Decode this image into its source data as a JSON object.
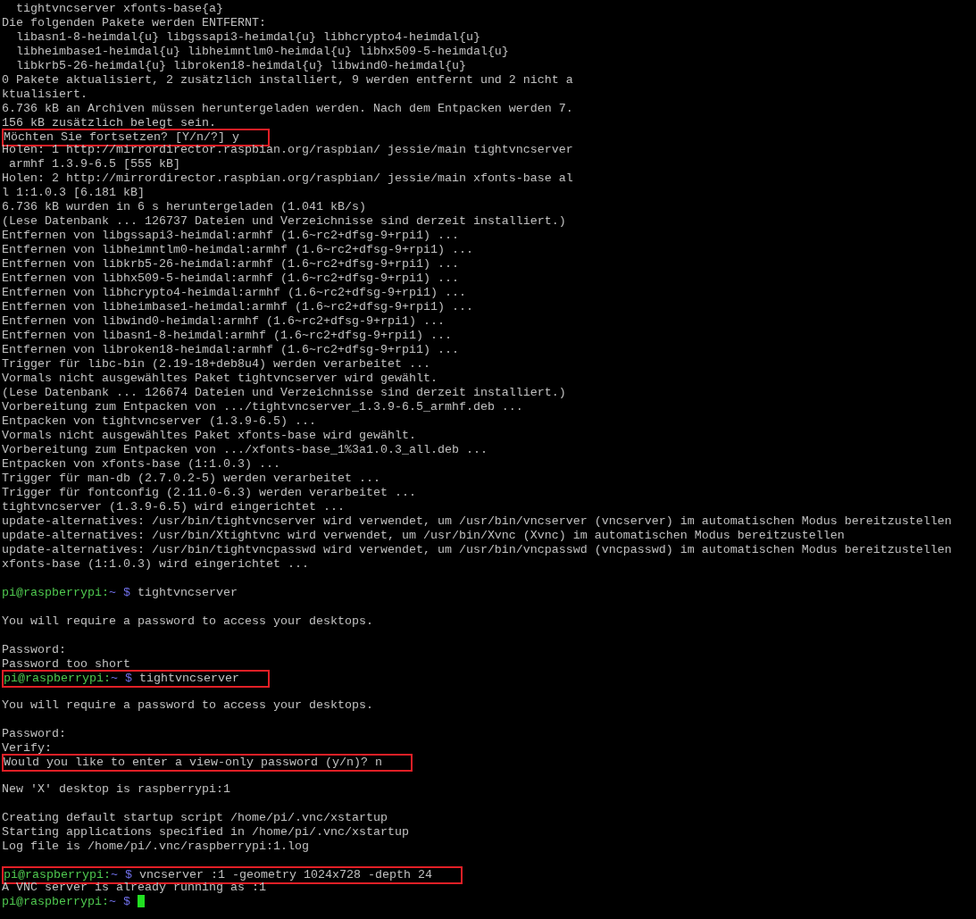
{
  "terminal": {
    "lines": [
      {
        "kind": "text",
        "text": "  tightvncserver xfonts-base{a}",
        "highlighted": false
      },
      {
        "kind": "text",
        "text": "Die folgenden Pakete werden ENTFERNT:",
        "highlighted": false
      },
      {
        "kind": "text",
        "text": "  libasn1-8-heimdal{u} libgssapi3-heimdal{u} libhcrypto4-heimdal{u}",
        "highlighted": false
      },
      {
        "kind": "text",
        "text": "  libheimbase1-heimdal{u} libheimntlm0-heimdal{u} libhx509-5-heimdal{u}",
        "highlighted": false
      },
      {
        "kind": "text",
        "text": "  libkrb5-26-heimdal{u} libroken18-heimdal{u} libwind0-heimdal{u}",
        "highlighted": false
      },
      {
        "kind": "text",
        "text": "0 Pakete aktualisiert, 2 zusätzlich installiert, 9 werden entfernt und 2 nicht a",
        "highlighted": false
      },
      {
        "kind": "text",
        "text": "ktualisiert.",
        "highlighted": false
      },
      {
        "kind": "text",
        "text": "6.736 kB an Archiven müssen heruntergeladen werden. Nach dem Entpacken werden 7.",
        "highlighted": false
      },
      {
        "kind": "text",
        "text": "156 kB zusätzlich belegt sein.",
        "highlighted": false
      },
      {
        "kind": "text",
        "text": "Möchten Sie fortsetzen? [Y/n/?] y",
        "highlighted": true
      },
      {
        "kind": "text",
        "text": "Holen: 1 http://mirrordirector.raspbian.org/raspbian/ jessie/main tightvncserver",
        "highlighted": false
      },
      {
        "kind": "text",
        "text": " armhf 1.3.9-6.5 [555 kB]",
        "highlighted": false
      },
      {
        "kind": "text",
        "text": "Holen: 2 http://mirrordirector.raspbian.org/raspbian/ jessie/main xfonts-base al",
        "highlighted": false
      },
      {
        "kind": "text",
        "text": "l 1:1.0.3 [6.181 kB]",
        "highlighted": false
      },
      {
        "kind": "text",
        "text": "6.736 kB wurden in 6 s heruntergeladen (1.041 kB/s)",
        "highlighted": false
      },
      {
        "kind": "text",
        "text": "(Lese Datenbank ... 126737 Dateien und Verzeichnisse sind derzeit installiert.)",
        "highlighted": false
      },
      {
        "kind": "text",
        "text": "Entfernen von libgssapi3-heimdal:armhf (1.6~rc2+dfsg-9+rpi1) ...",
        "highlighted": false
      },
      {
        "kind": "text",
        "text": "Entfernen von libheimntlm0-heimdal:armhf (1.6~rc2+dfsg-9+rpi1) ...",
        "highlighted": false
      },
      {
        "kind": "text",
        "text": "Entfernen von libkrb5-26-heimdal:armhf (1.6~rc2+dfsg-9+rpi1) ...",
        "highlighted": false
      },
      {
        "kind": "text",
        "text": "Entfernen von libhx509-5-heimdal:armhf (1.6~rc2+dfsg-9+rpi1) ...",
        "highlighted": false
      },
      {
        "kind": "text",
        "text": "Entfernen von libhcrypto4-heimdal:armhf (1.6~rc2+dfsg-9+rpi1) ...",
        "highlighted": false
      },
      {
        "kind": "text",
        "text": "Entfernen von libheimbase1-heimdal:armhf (1.6~rc2+dfsg-9+rpi1) ...",
        "highlighted": false
      },
      {
        "kind": "text",
        "text": "Entfernen von libwind0-heimdal:armhf (1.6~rc2+dfsg-9+rpi1) ...",
        "highlighted": false
      },
      {
        "kind": "text",
        "text": "Entfernen von libasn1-8-heimdal:armhf (1.6~rc2+dfsg-9+rpi1) ...",
        "highlighted": false
      },
      {
        "kind": "text",
        "text": "Entfernen von libroken18-heimdal:armhf (1.6~rc2+dfsg-9+rpi1) ...",
        "highlighted": false
      },
      {
        "kind": "text",
        "text": "Trigger für libc-bin (2.19-18+deb8u4) werden verarbeitet ...",
        "highlighted": false
      },
      {
        "kind": "text",
        "text": "Vormals nicht ausgewähltes Paket tightvncserver wird gewählt.",
        "highlighted": false
      },
      {
        "kind": "text",
        "text": "(Lese Datenbank ... 126674 Dateien und Verzeichnisse sind derzeit installiert.)",
        "highlighted": false
      },
      {
        "kind": "text",
        "text": "Vorbereitung zum Entpacken von .../tightvncserver_1.3.9-6.5_armhf.deb ...",
        "highlighted": false
      },
      {
        "kind": "text",
        "text": "Entpacken von tightvncserver (1.3.9-6.5) ...",
        "highlighted": false
      },
      {
        "kind": "text",
        "text": "Vormals nicht ausgewähltes Paket xfonts-base wird gewählt.",
        "highlighted": false
      },
      {
        "kind": "text",
        "text": "Vorbereitung zum Entpacken von .../xfonts-base_1%3a1.0.3_all.deb ...",
        "highlighted": false
      },
      {
        "kind": "text",
        "text": "Entpacken von xfonts-base (1:1.0.3) ...",
        "highlighted": false
      },
      {
        "kind": "text",
        "text": "Trigger für man-db (2.7.0.2-5) werden verarbeitet ...",
        "highlighted": false
      },
      {
        "kind": "text",
        "text": "Trigger für fontconfig (2.11.0-6.3) werden verarbeitet ...",
        "highlighted": false
      },
      {
        "kind": "text",
        "text": "tightvncserver (1.3.9-6.5) wird eingerichtet ...",
        "highlighted": false
      },
      {
        "kind": "text",
        "text": "update-alternatives: /usr/bin/tightvncserver wird verwendet, um /usr/bin/vncserver (vncserver) im automatischen Modus bereitzustellen",
        "highlighted": false
      },
      {
        "kind": "text",
        "text": "update-alternatives: /usr/bin/Xtightvnc wird verwendet, um /usr/bin/Xvnc (Xvnc) im automatischen Modus bereitzustellen",
        "highlighted": false
      },
      {
        "kind": "text",
        "text": "update-alternatives: /usr/bin/tightvncpasswd wird verwendet, um /usr/bin/vncpasswd (vncpasswd) im automatischen Modus bereitzustellen",
        "highlighted": false
      },
      {
        "kind": "text",
        "text": "xfonts-base (1:1.0.3) wird eingerichtet ...",
        "highlighted": false
      },
      {
        "kind": "blank"
      },
      {
        "kind": "prompt",
        "host": "pi@raspberrypi:",
        "path": "~ $",
        "command": "tightvncserver",
        "highlighted": false,
        "cursor": false
      },
      {
        "kind": "blank"
      },
      {
        "kind": "text",
        "text": "You will require a password to access your desktops.",
        "highlighted": false
      },
      {
        "kind": "blank"
      },
      {
        "kind": "text",
        "text": "Password:",
        "highlighted": false
      },
      {
        "kind": "text",
        "text": "Password too short",
        "highlighted": false
      },
      {
        "kind": "prompt",
        "host": "pi@raspberrypi:",
        "path": "~ $",
        "command": "tightvncserver",
        "highlighted": true,
        "cursor": false
      },
      {
        "kind": "blank"
      },
      {
        "kind": "text",
        "text": "You will require a password to access your desktops.",
        "highlighted": false
      },
      {
        "kind": "blank"
      },
      {
        "kind": "text",
        "text": "Password:",
        "highlighted": false
      },
      {
        "kind": "text",
        "text": "Verify:",
        "highlighted": false
      },
      {
        "kind": "text",
        "text": "Would you like to enter a view-only password (y/n)? n",
        "highlighted": true
      },
      {
        "kind": "blank"
      },
      {
        "kind": "text",
        "text": "New 'X' desktop is raspberrypi:1",
        "highlighted": false
      },
      {
        "kind": "blank"
      },
      {
        "kind": "text",
        "text": "Creating default startup script /home/pi/.vnc/xstartup",
        "highlighted": false
      },
      {
        "kind": "text",
        "text": "Starting applications specified in /home/pi/.vnc/xstartup",
        "highlighted": false
      },
      {
        "kind": "text",
        "text": "Log file is /home/pi/.vnc/raspberrypi:1.log",
        "highlighted": false
      },
      {
        "kind": "blank"
      },
      {
        "kind": "prompt",
        "host": "pi@raspberrypi:",
        "path": "~ $",
        "command": "vncserver :1 -geometry 1024x728 -depth 24",
        "highlighted": true,
        "cursor": false
      },
      {
        "kind": "text",
        "text": "A VNC server is already running as :1",
        "highlighted": false
      },
      {
        "kind": "prompt",
        "host": "pi@raspberrypi:",
        "path": "~ $",
        "highlighted": false,
        "cursor": true
      }
    ]
  }
}
